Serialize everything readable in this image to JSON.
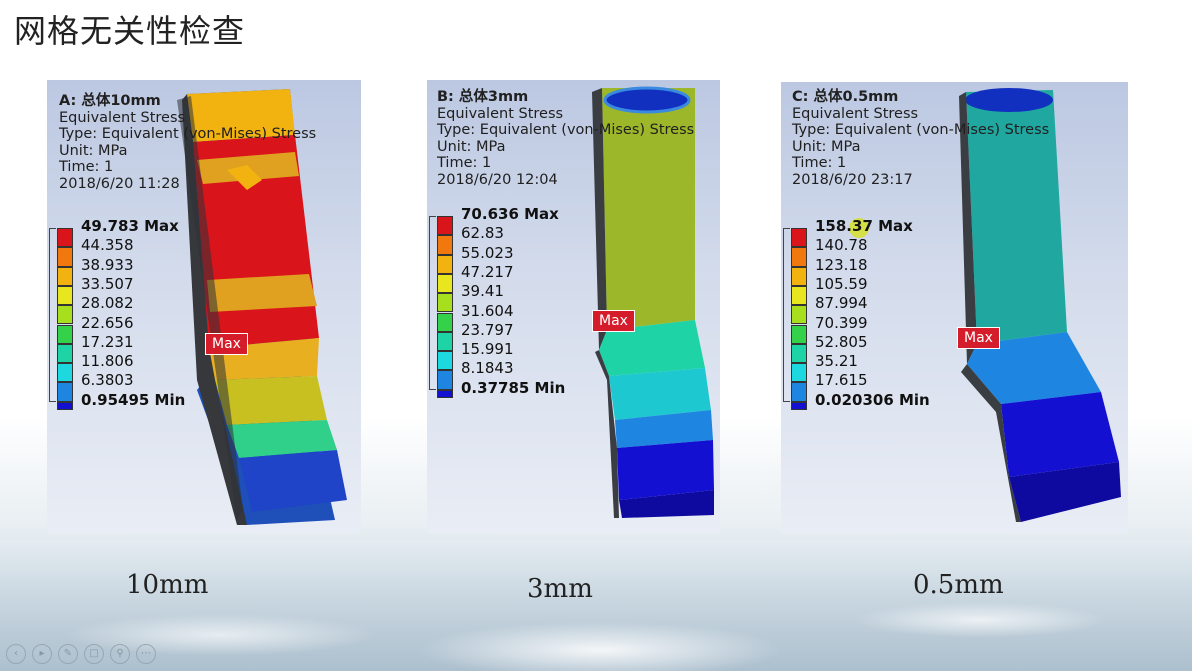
{
  "slide": {
    "title": "网格无关性检查",
    "captions": [
      "10mm",
      "3mm",
      "0.5mm"
    ]
  },
  "panels": [
    {
      "name": "A: 总体10mm",
      "result": "Equivalent Stress",
      "type": "Type: Equivalent (von-Mises) Stress",
      "unit": "Unit: MPa",
      "time": "Time: 1",
      "date": "2018/6/20 11:28",
      "legend": [
        "49.783 Max",
        "44.358",
        "38.933",
        "33.507",
        "28.082",
        "22.656",
        "17.231",
        "11.806",
        "6.3803",
        "0.95495 Min"
      ],
      "max_tag": "Max"
    },
    {
      "name": "B: 总体3mm",
      "result": "Equivalent Stress",
      "type": "Type: Equivalent (von-Mises) Stress",
      "unit": "Unit: MPa",
      "time": "Time: 1",
      "date": "2018/6/20 12:04",
      "legend": [
        "70.636 Max",
        "62.83",
        "55.023",
        "47.217",
        "39.41",
        "31.604",
        "23.797",
        "15.991",
        "8.1843",
        "0.37785 Min"
      ],
      "max_tag": "Max"
    },
    {
      "name": "C: 总体0.5mm",
      "result": "Equivalent Stress",
      "type": "Type: Equivalent (von-Mises) Stress",
      "unit": "Unit: MPa",
      "time": "Time: 1",
      "date": "2018/6/20 23:17",
      "legend": [
        "158.37 Max",
        "140.78",
        "123.18",
        "105.59",
        "87.994",
        "70.399",
        "52.805",
        "35.21",
        "17.615",
        "0.020306 Min"
      ],
      "max_tag": "Max"
    }
  ],
  "colors": {
    "scale": [
      "#d9141b",
      "#f0780f",
      "#f2b311",
      "#e8e61e",
      "#a7de1d",
      "#33d24a",
      "#1ed4a6",
      "#1ed8e0",
      "#1e86e0",
      "#1410d2",
      "#ffffff"
    ],
    "max_tag": "#d51c2a"
  },
  "footer_icons": [
    "prev-icon",
    "play-icon",
    "pen-icon",
    "copy-icon",
    "zoom-icon",
    "more-icon"
  ]
}
